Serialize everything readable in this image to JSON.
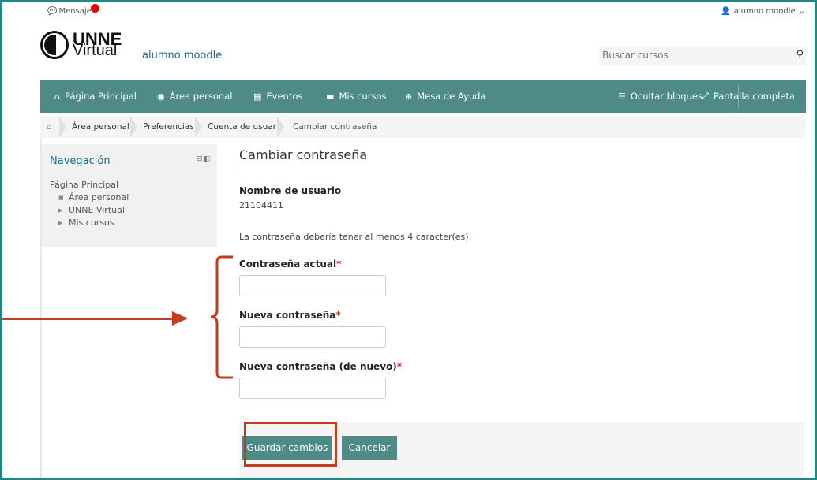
{
  "topbar": {
    "messages_label": "Mensajes",
    "user_name": "alumno moodle",
    "user_chevron": "⌄"
  },
  "header": {
    "logo_line1": "UNNE",
    "logo_line2": "Virtual",
    "site_name": "alumno moodle",
    "search_placeholder": "Buscar cursos"
  },
  "nav": {
    "items": [
      {
        "icon": "home-icon",
        "label": "Página Principal"
      },
      {
        "icon": "dashboard-icon",
        "label": "Área personal"
      },
      {
        "icon": "calendar-icon",
        "label": "Eventos"
      },
      {
        "icon": "courses-icon",
        "label": "Mis cursos"
      },
      {
        "icon": "help-icon",
        "label": "Mesa de Ayuda"
      }
    ],
    "right": [
      {
        "icon": "list-icon",
        "label": "Ocultar bloques"
      },
      {
        "icon": "expand-icon",
        "label": "Pantalla completa"
      }
    ]
  },
  "breadcrumb": [
    "Área personal",
    "Preferencias",
    "Cuenta de usuario",
    "Cambiar contraseña"
  ],
  "navblock": {
    "title": "Navegación",
    "root": "Página Principal",
    "items": [
      "Área personal",
      "UNNE Virtual",
      "Mis cursos"
    ]
  },
  "main": {
    "heading": "Cambiar contraseña",
    "username_label": "Nombre de usuario",
    "username_value": "21104411",
    "rule_note": "La contraseña debería tener al menos 4 caracter(es)",
    "fields": [
      {
        "label": "Contraseña actual",
        "required": "*"
      },
      {
        "label": "Nueva contraseña",
        "required": "*"
      },
      {
        "label": "Nueva contraseña (de nuevo)",
        "required": "*"
      }
    ],
    "save_label": "Guardar cambios",
    "cancel_label": "Cancelar"
  },
  "colors": {
    "accent": "#4e8b86",
    "frame": "#1f8a83",
    "annotation": "#c43b1e"
  }
}
